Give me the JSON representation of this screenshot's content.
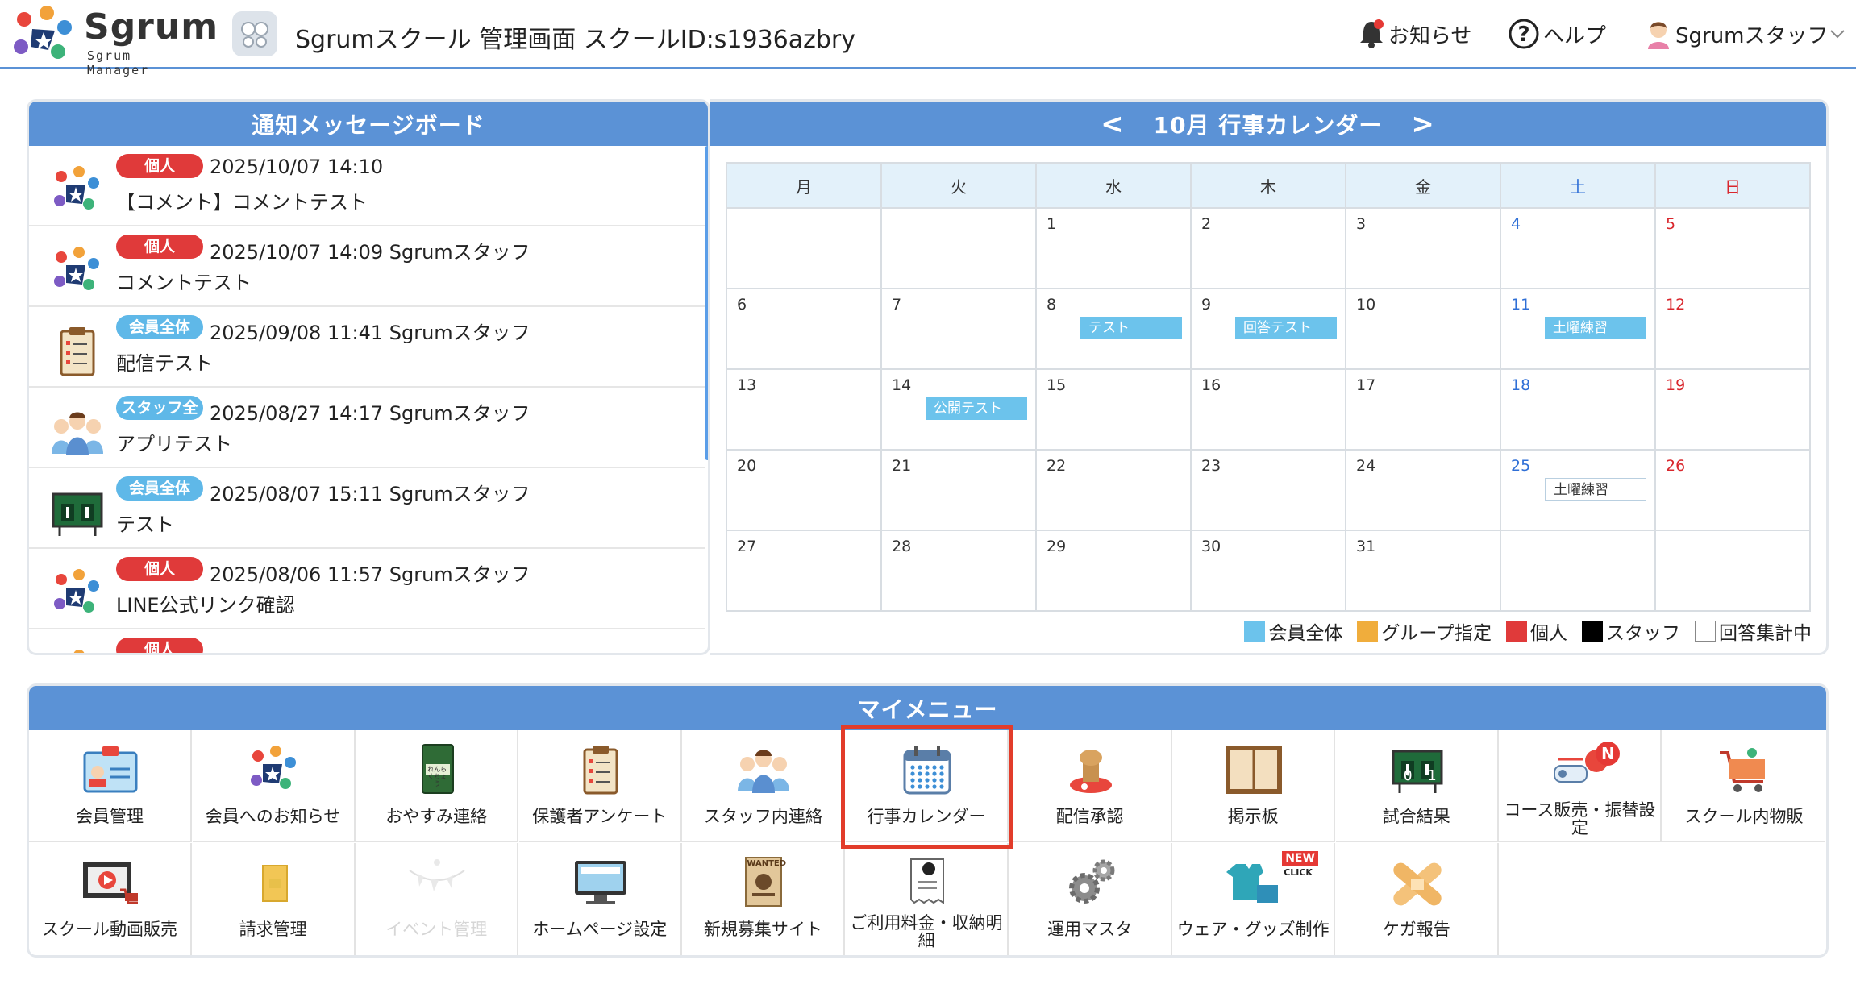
{
  "header": {
    "logo_name": "Sgrum",
    "logo_sub": "Sgrum Manager",
    "school_title": "Sgrumスクール 管理画面 スクールID:s1936azbry",
    "notice_label": "お知らせ",
    "help_label": "ヘルプ",
    "user_label": "Sgrumスタッフ",
    "icons": [
      "logo-mark",
      "school-emblem",
      "bell-icon",
      "help-icon",
      "user-avatar-icon",
      "chevron-down-icon"
    ]
  },
  "board": {
    "title": "通知メッセージボード",
    "items": [
      {
        "badge": "個人",
        "badge_color": "#e03a3a",
        "meta": "2025/10/07 14:10",
        "body": "【コメント】コメントテスト",
        "icon": "sgrum-logo-icon"
      },
      {
        "badge": "個人",
        "badge_color": "#e03a3a",
        "meta": "2025/10/07 14:09 Sgrumスタッフ",
        "body": "コメントテスト",
        "icon": "sgrum-logo-icon"
      },
      {
        "badge": "会員全体",
        "badge_color": "#5fb8e8",
        "meta": "2025/09/08 11:41 Sgrumスタッフ",
        "body": "配信テスト",
        "icon": "clipboard-icon"
      },
      {
        "badge": "スタッフ全体",
        "badge_color": "#5fb8e8",
        "meta": "2025/08/27 14:17 Sgrumスタッフ",
        "body": "アプリテスト",
        "icon": "staff-group-icon"
      },
      {
        "badge": "会員全体",
        "badge_color": "#5fb8e8",
        "meta": "2025/08/07 15:11 Sgrumスタッフ",
        "body": "テスト",
        "icon": "scoreboard-icon"
      },
      {
        "badge": "個人",
        "badge_color": "#e03a3a",
        "meta": "2025/08/06 11:57 Sgrumスタッフ",
        "body": "LINE公式リンク確認",
        "icon": "sgrum-logo-icon"
      },
      {
        "badge": "個人",
        "badge_color": "#e03a3a",
        "meta": "",
        "body": "",
        "icon": "sgrum-logo-icon"
      }
    ]
  },
  "calendar": {
    "title": "10月 行事カレンダー",
    "prev": "<",
    "next": ">",
    "weekdays": [
      "月",
      "火",
      "水",
      "木",
      "金",
      "土",
      "日"
    ],
    "weeks": [
      [
        "",
        "",
        "1",
        "2",
        "3",
        "4",
        "5"
      ],
      [
        "6",
        "7",
        "8",
        "9",
        "10",
        "11",
        "12"
      ],
      [
        "13",
        "14",
        "15",
        "16",
        "17",
        "18",
        "19"
      ],
      [
        "20",
        "21",
        "22",
        "23",
        "24",
        "25",
        "26"
      ],
      [
        "27",
        "28",
        "29",
        "30",
        "31",
        "",
        ""
      ]
    ],
    "events": [
      {
        "week": 1,
        "day": 2,
        "label": "テスト",
        "style": "filled"
      },
      {
        "week": 1,
        "day": 3,
        "label": "回答テスト",
        "style": "filled"
      },
      {
        "week": 1,
        "day": 5,
        "label": "土曜練習",
        "style": "filled"
      },
      {
        "week": 2,
        "day": 1,
        "label": "公開テスト",
        "style": "filled"
      },
      {
        "week": 3,
        "day": 5,
        "label": "土曜練習",
        "style": "outline"
      }
    ],
    "legend": [
      {
        "label": "会員全体",
        "color": "#6cc3ec"
      },
      {
        "label": "グループ指定",
        "color": "#f0ad3c"
      },
      {
        "label": "個人",
        "color": "#e03a3a"
      },
      {
        "label": "スタッフ",
        "color": "#000000"
      },
      {
        "label": "回答集計中",
        "color": "#ffffff"
      }
    ]
  },
  "mymenu": {
    "title": "マイメニュー",
    "items": [
      {
        "label": "会員管理",
        "icon": "member-card-icon",
        "enabled": true
      },
      {
        "label": "会員へのお知らせ",
        "icon": "sgrum-logo-icon",
        "enabled": true
      },
      {
        "label": "おやすみ連絡",
        "icon": "contact-book-icon",
        "enabled": true
      },
      {
        "label": "保護者アンケート",
        "icon": "clipboard-icon",
        "enabled": true
      },
      {
        "label": "スタッフ内連絡",
        "icon": "staff-group-icon",
        "enabled": true
      },
      {
        "label": "行事カレンダー",
        "icon": "calendar-icon",
        "enabled": true
      },
      {
        "label": "配信承認",
        "icon": "stamp-icon",
        "enabled": true
      },
      {
        "label": "掲示板",
        "icon": "bulletin-board-icon",
        "enabled": true
      },
      {
        "label": "試合結果",
        "icon": "scoreboard-icon",
        "enabled": true
      },
      {
        "label": "コース販売・振替設定",
        "icon": "course-sale-icon",
        "enabled": true
      },
      {
        "label": "スクール内物販",
        "icon": "shopping-cart-icon",
        "enabled": true
      },
      {
        "label": "スクール動画販売",
        "icon": "video-sale-icon",
        "enabled": true
      },
      {
        "label": "請求管理",
        "icon": "invoice-envelope-icon",
        "enabled": true
      },
      {
        "label": "イベント管理",
        "icon": "event-garland-icon",
        "enabled": false
      },
      {
        "label": "ホームページ設定",
        "icon": "monitor-icon",
        "enabled": true
      },
      {
        "label": "新規募集サイト",
        "icon": "wanted-poster-icon",
        "enabled": true
      },
      {
        "label": "ご利用料金・収納明細",
        "icon": "receipt-icon",
        "enabled": true
      },
      {
        "label": "運用マスタ",
        "icon": "gears-icon",
        "enabled": true
      },
      {
        "label": "ウェア・グッズ制作",
        "icon": "uniform-icon",
        "enabled": true
      },
      {
        "label": "ケガ報告",
        "icon": "bandage-icon",
        "enabled": true
      }
    ],
    "highlighted": "行事カレンダー",
    "badge_new": "NEW",
    "badge_click": "CLICK",
    "badge_n": "N",
    "contact_book_text": "れんらくちょう",
    "scoreboard_text": "0 1",
    "wanted_text": "WANTED"
  }
}
